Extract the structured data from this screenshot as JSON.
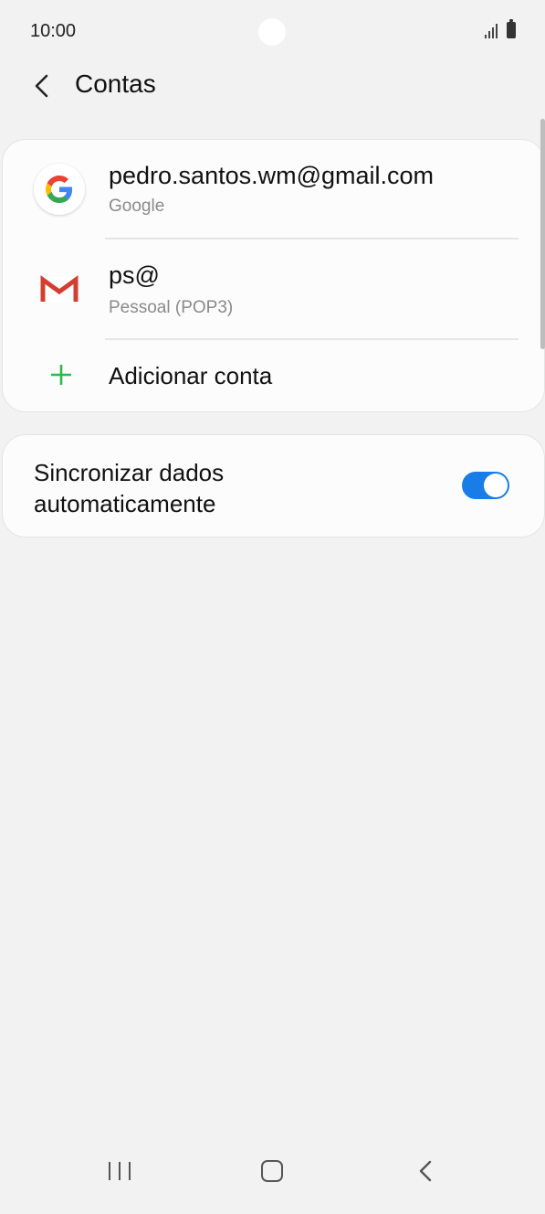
{
  "status_bar": {
    "time": "10:00"
  },
  "header": {
    "title": "Contas"
  },
  "accounts": [
    {
      "name": "pedro.santos.wm@gmail.com",
      "type": "Google",
      "icon": "google-icon"
    },
    {
      "name": "ps@",
      "type": "Pessoal (POP3)",
      "icon": "gmail-icon"
    }
  ],
  "add_account": {
    "label": "Adicionar conta",
    "icon": "plus-icon"
  },
  "sync": {
    "label": "Sincronizar dados automaticamente",
    "enabled": true
  },
  "colors": {
    "accent": "#1a7ce6",
    "plus": "#2eb84b",
    "background": "#f2f2f2"
  }
}
